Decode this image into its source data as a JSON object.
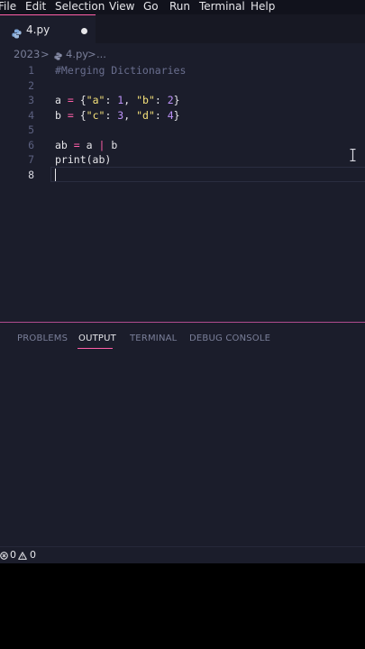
{
  "menu": [
    "File",
    "Edit",
    "Selection",
    "View",
    "Go",
    "Run",
    "Terminal",
    "Help"
  ],
  "tab": {
    "label": "4.py"
  },
  "breadcrumb": {
    "folder": "2023",
    "sep": ">",
    "file": "4.py",
    "sep2": ">",
    "more": "..."
  },
  "editor": {
    "line_numbers": [
      "1",
      "2",
      "3",
      "4",
      "5",
      "6",
      "7",
      "8"
    ],
    "comment": "#Merging Dictionaries",
    "a": {
      "name": "a",
      "eq": " = ",
      "open": "{",
      "k1": "\"a\"",
      "c1": ": ",
      "v1": "1",
      "sep": ", ",
      "k2": "\"b\"",
      "c2": ": ",
      "v2": "2",
      "close": "}"
    },
    "b": {
      "name": "b",
      "eq": " = ",
      "open": "{",
      "k1": "\"c\"",
      "c1": ": ",
      "v1": "3",
      "sep": ", ",
      "k2": "\"d\"",
      "c2": ": ",
      "v2": "4",
      "close": "}"
    },
    "ab": {
      "name": "ab",
      "eq": " = ",
      "l": "a",
      "pipe": " | ",
      "r": "b"
    },
    "print": {
      "fn": "print",
      "args": "(ab)"
    }
  },
  "panel": {
    "tabs": [
      "PROBLEMS",
      "OUTPUT",
      "TERMINAL",
      "DEBUG CONSOLE"
    ],
    "active": "OUTPUT"
  },
  "status": {
    "errors": "0",
    "warnings": "0"
  },
  "colors": {
    "accent": "#ff5fa8",
    "background": "#1b1d2b",
    "string": "#f6e27a",
    "number": "#bd93f9",
    "comment": "#6a6f8f"
  },
  "icons": {
    "tab": "python-file-icon",
    "status_errors": "error-circle-icon",
    "status_warnings": "warning-triangle-icon"
  }
}
